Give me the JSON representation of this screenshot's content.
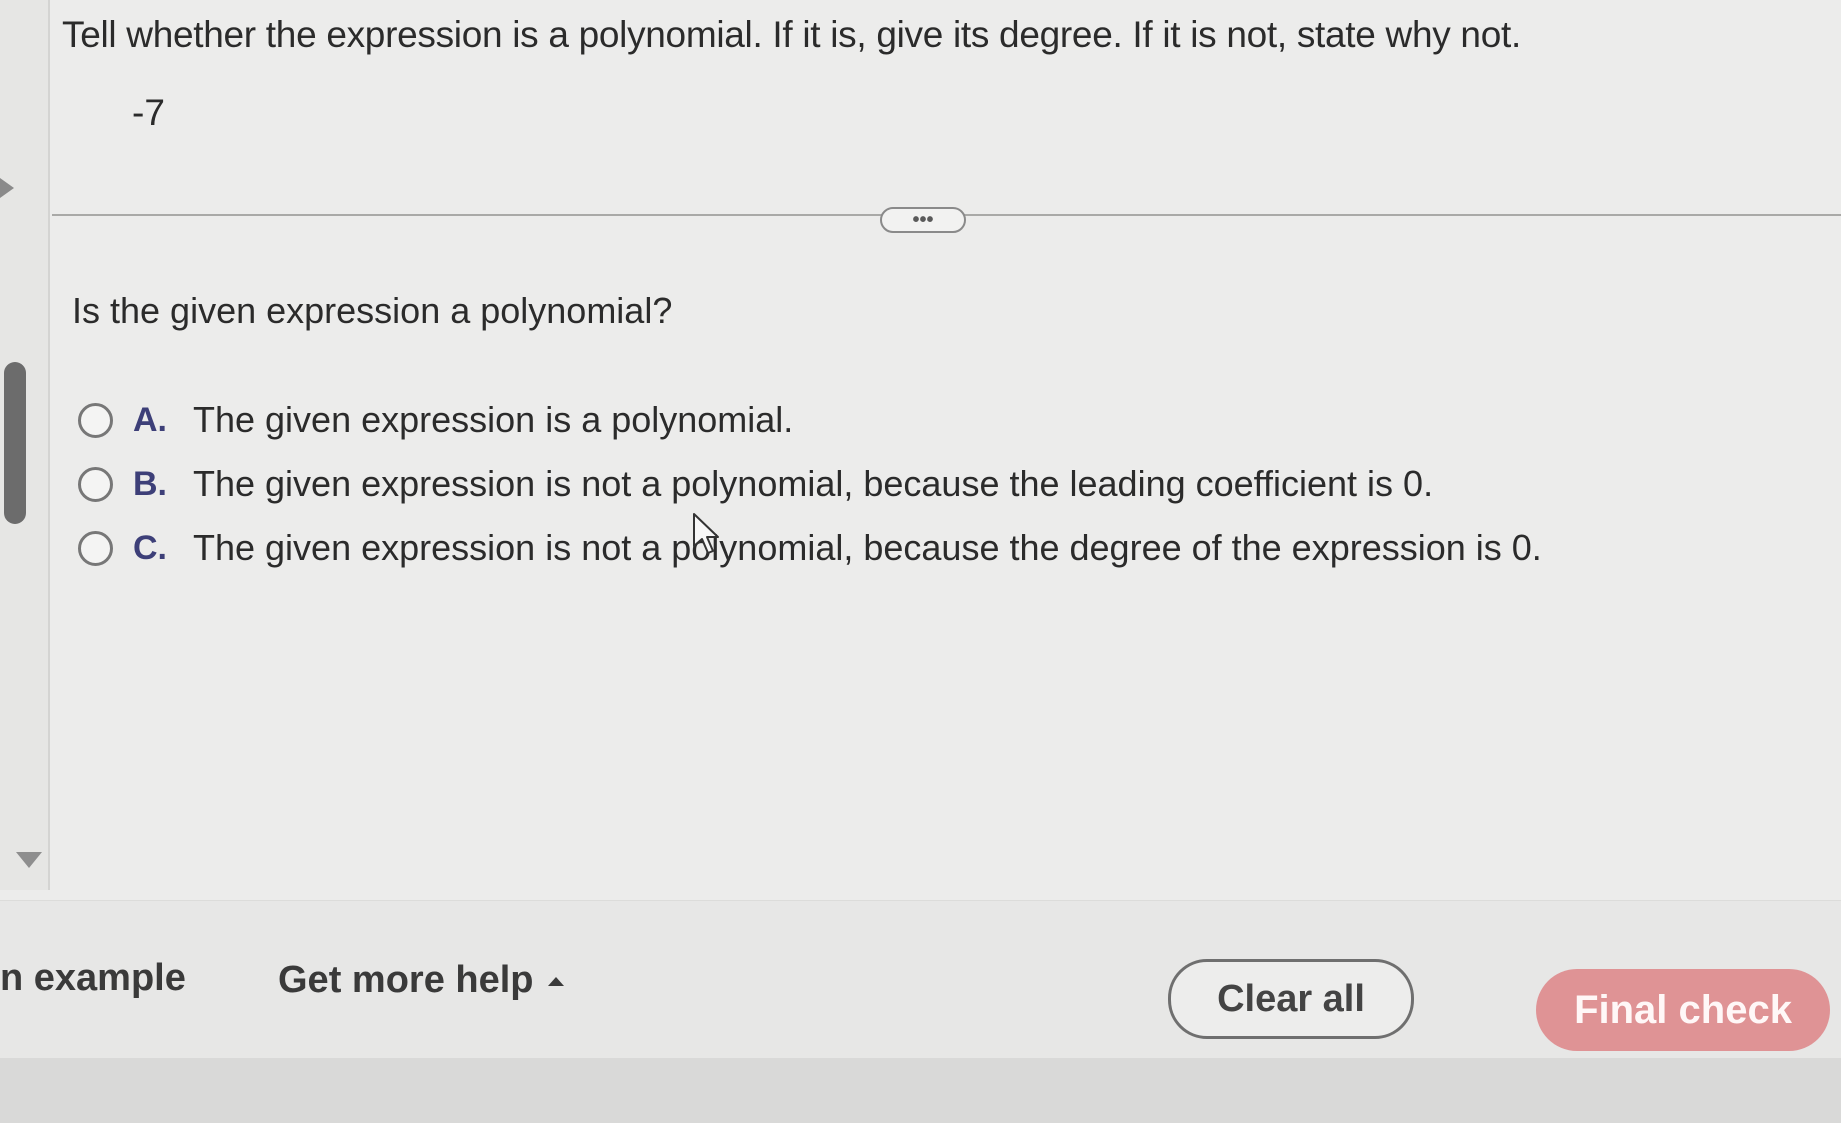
{
  "question": {
    "instructions": "Tell whether the expression is a polynomial. If it is, give its degree. If it is not, state why not.",
    "expression": "-7",
    "more_label": "•••",
    "prompt": "Is the given expression a polynomial?",
    "options": [
      {
        "letter": "A.",
        "text": "The given expression is a polynomial."
      },
      {
        "letter": "B.",
        "text": "The given expression is not a polynomial, because the leading coefficient is 0."
      },
      {
        "letter": "C.",
        "text": "The given expression is not a polynomial, because the degree of the expression is 0."
      }
    ]
  },
  "footer": {
    "example_label": "n example",
    "help_label": "Get more help",
    "clear_label": "Clear all",
    "final_label": "Final check"
  },
  "icons": {
    "cursor": "mouse-pointer-icon",
    "help_caret": "caret-up-icon",
    "rail_up": "triangle-left-icon",
    "rail_down": "triangle-down-icon"
  },
  "colors": {
    "option_letter": "#3d3f78",
    "final_button": "#df9395"
  }
}
